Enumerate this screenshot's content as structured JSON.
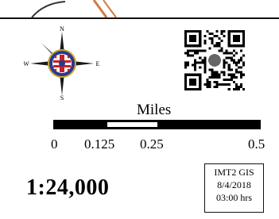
{
  "compass": {
    "north": "N",
    "east": "E",
    "south": "S",
    "west": "W",
    "colors": {
      "red": "#c8202a",
      "blue": "#2a3a8a",
      "gold": "#c9a23a"
    }
  },
  "qr_code": {
    "icon": "qr-code-icon"
  },
  "scale": {
    "unit_label": "Miles",
    "ticks": [
      {
        "label": "0"
      },
      {
        "label": "0.125"
      },
      {
        "label": "0.25"
      },
      {
        "label": "0.5"
      }
    ],
    "ratio": "1:24,000"
  },
  "stamp": {
    "org": "IMT2 GIS",
    "date": "8/4/2018",
    "time": "03:00 hrs"
  }
}
